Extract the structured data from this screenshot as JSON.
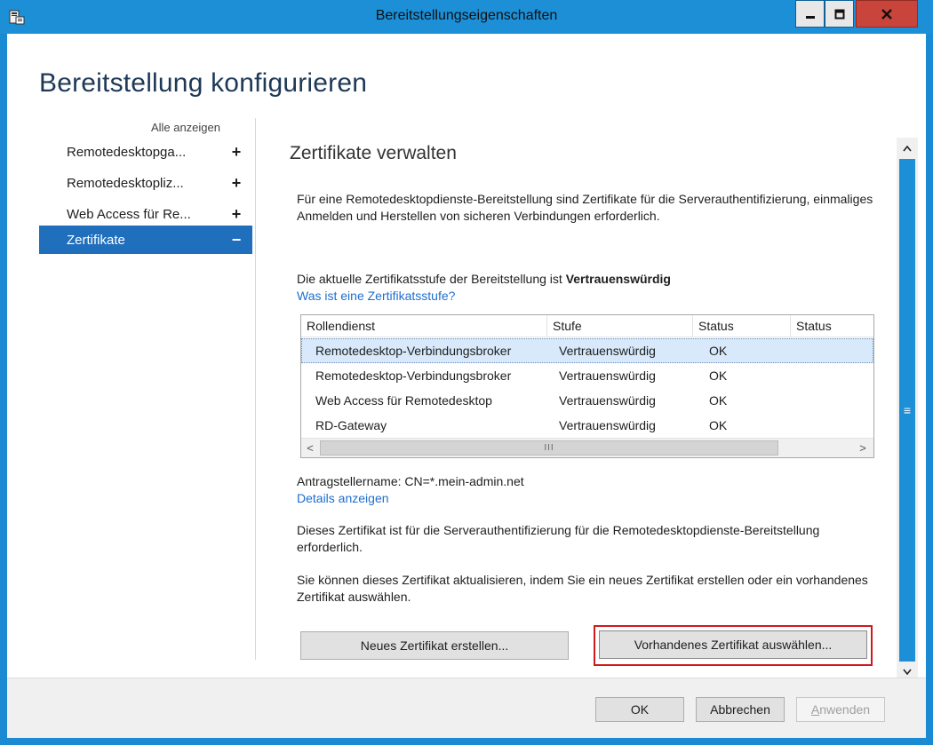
{
  "window": {
    "title": "Bereitstellungseigenschaften",
    "minimize_glyph": "–",
    "maximize_glyph": "□",
    "close_glyph": "x"
  },
  "page": {
    "title": "Bereitstellung konfigurieren"
  },
  "nav": {
    "show_all": "Alle anzeigen",
    "items": [
      {
        "label": "Remotedesktopga...",
        "sign": "+",
        "active": false
      },
      {
        "label": "Remotedesktopliz...",
        "sign": "+",
        "active": false
      },
      {
        "label": "Web Access für Re...",
        "sign": "+",
        "active": false
      },
      {
        "label": "Zertifikate",
        "sign": "−",
        "active": true
      }
    ]
  },
  "content": {
    "section_title": "Zertifikate verwalten",
    "intro": "Für eine Remotedesktopdienste-Bereitstellung sind Zertifikate für die Serverauthentifizierung, einmaliges Anmelden und Herstellen von sicheren Verbindungen erforderlich.",
    "level_prefix": "Die aktuelle Zertifikatsstufe der Bereitstellung ist ",
    "level_value": "Vertrauenswürdig",
    "level_link": "Was ist eine Zertifikatsstufe?",
    "table": {
      "columns": [
        "Rollendienst",
        "Stufe",
        "Status",
        "Status"
      ],
      "rows": [
        {
          "role": "Remotedesktop-Verbindungsbroker",
          "level": "Vertrauenswürdig",
          "status": "OK",
          "status2": "",
          "selected": true
        },
        {
          "role": "Remotedesktop-Verbindungsbroker",
          "level": "Vertrauenswürdig",
          "status": "OK",
          "status2": "",
          "selected": false
        },
        {
          "role": "Web Access für Remotedesktop",
          "level": "Vertrauenswürdig",
          "status": "OK",
          "status2": "",
          "selected": false
        },
        {
          "role": "RD-Gateway",
          "level": "Vertrauenswürdig",
          "status": "OK",
          "status2": "",
          "selected": false
        }
      ],
      "scroll_left": "<",
      "scroll_right": ">",
      "scroll_grip": "III"
    },
    "subject_name": "Antragstellername: CN=*.mein-admin.net",
    "details_link": "Details anzeigen",
    "cert_required": "Dieses Zertifikat ist für die Serverauthentifizierung für die Remotedesktopdienste-Bereitstellung erforderlich.",
    "update_hint": "Sie können dieses Zertifikat aktualisieren, indem Sie ein neues Zertifikat erstellen oder ein vorhandenes Zertifikat auswählen.",
    "new_cert_button": "Neues Zertifikat erstellen...",
    "existing_cert_button": "Vorhandenes Zertifikat auswählen..."
  },
  "scrollbar": {
    "up": "∧",
    "down": "∨",
    "grip": "≡"
  },
  "footer": {
    "ok": "OK",
    "cancel": "Abbrechen",
    "apply_mnemonic": "A",
    "apply_rest": "nwenden"
  },
  "colors": {
    "titlebar": "#1c8fd6",
    "nav_active": "#1f6fbd",
    "link": "#1e6ed0",
    "highlight": "#d0191d",
    "close_button": "#c9443b"
  },
  "icons": {
    "app": "server-properties-icon",
    "close": "close-icon",
    "minimize": "minimize-icon",
    "maximize": "maximize-icon"
  }
}
